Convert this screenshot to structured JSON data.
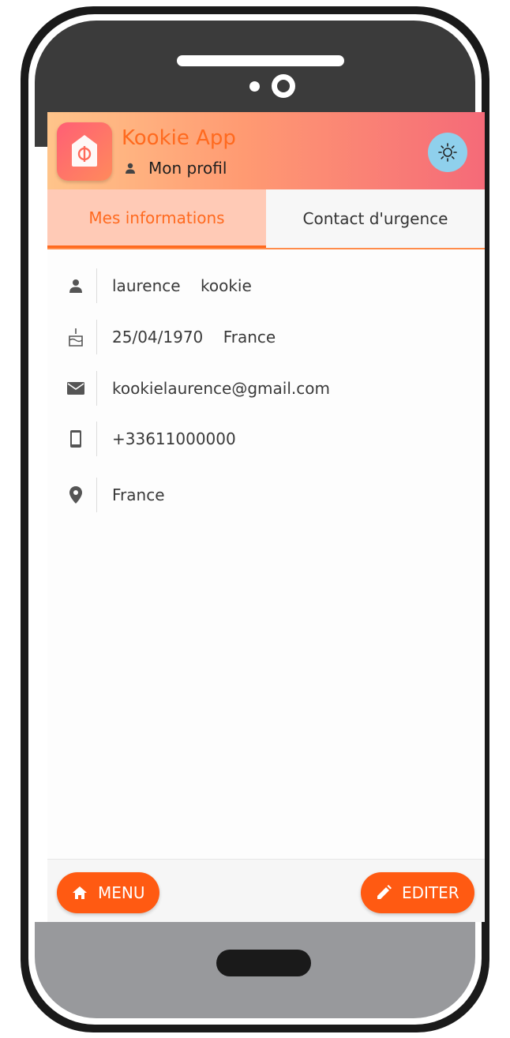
{
  "app": {
    "title": "Kookie App",
    "subtitle": "Mon profil",
    "brand_color": "#ff6a1f"
  },
  "tabs": [
    {
      "label": "Mes informations",
      "active": true
    },
    {
      "label": "Contact d'urgence",
      "active": false
    }
  ],
  "profile": {
    "name": "laurence    kookie",
    "birth": "25/04/1970    France",
    "email": "kookielaurence@gmail.com",
    "phone": "+33611000000",
    "location": "France"
  },
  "icons": {
    "logo": "house-phi-logo",
    "subtitle": "person-icon",
    "theme": "sun-icon",
    "name": "person-icon",
    "birth": "cake-icon",
    "email": "mail-icon",
    "phone": "smartphone-icon",
    "location": "location-pin-icon",
    "menu": "home-icon",
    "edit": "pencil-icon"
  },
  "actions": {
    "menu_label": "MENU",
    "edit_label": "EDITER"
  }
}
